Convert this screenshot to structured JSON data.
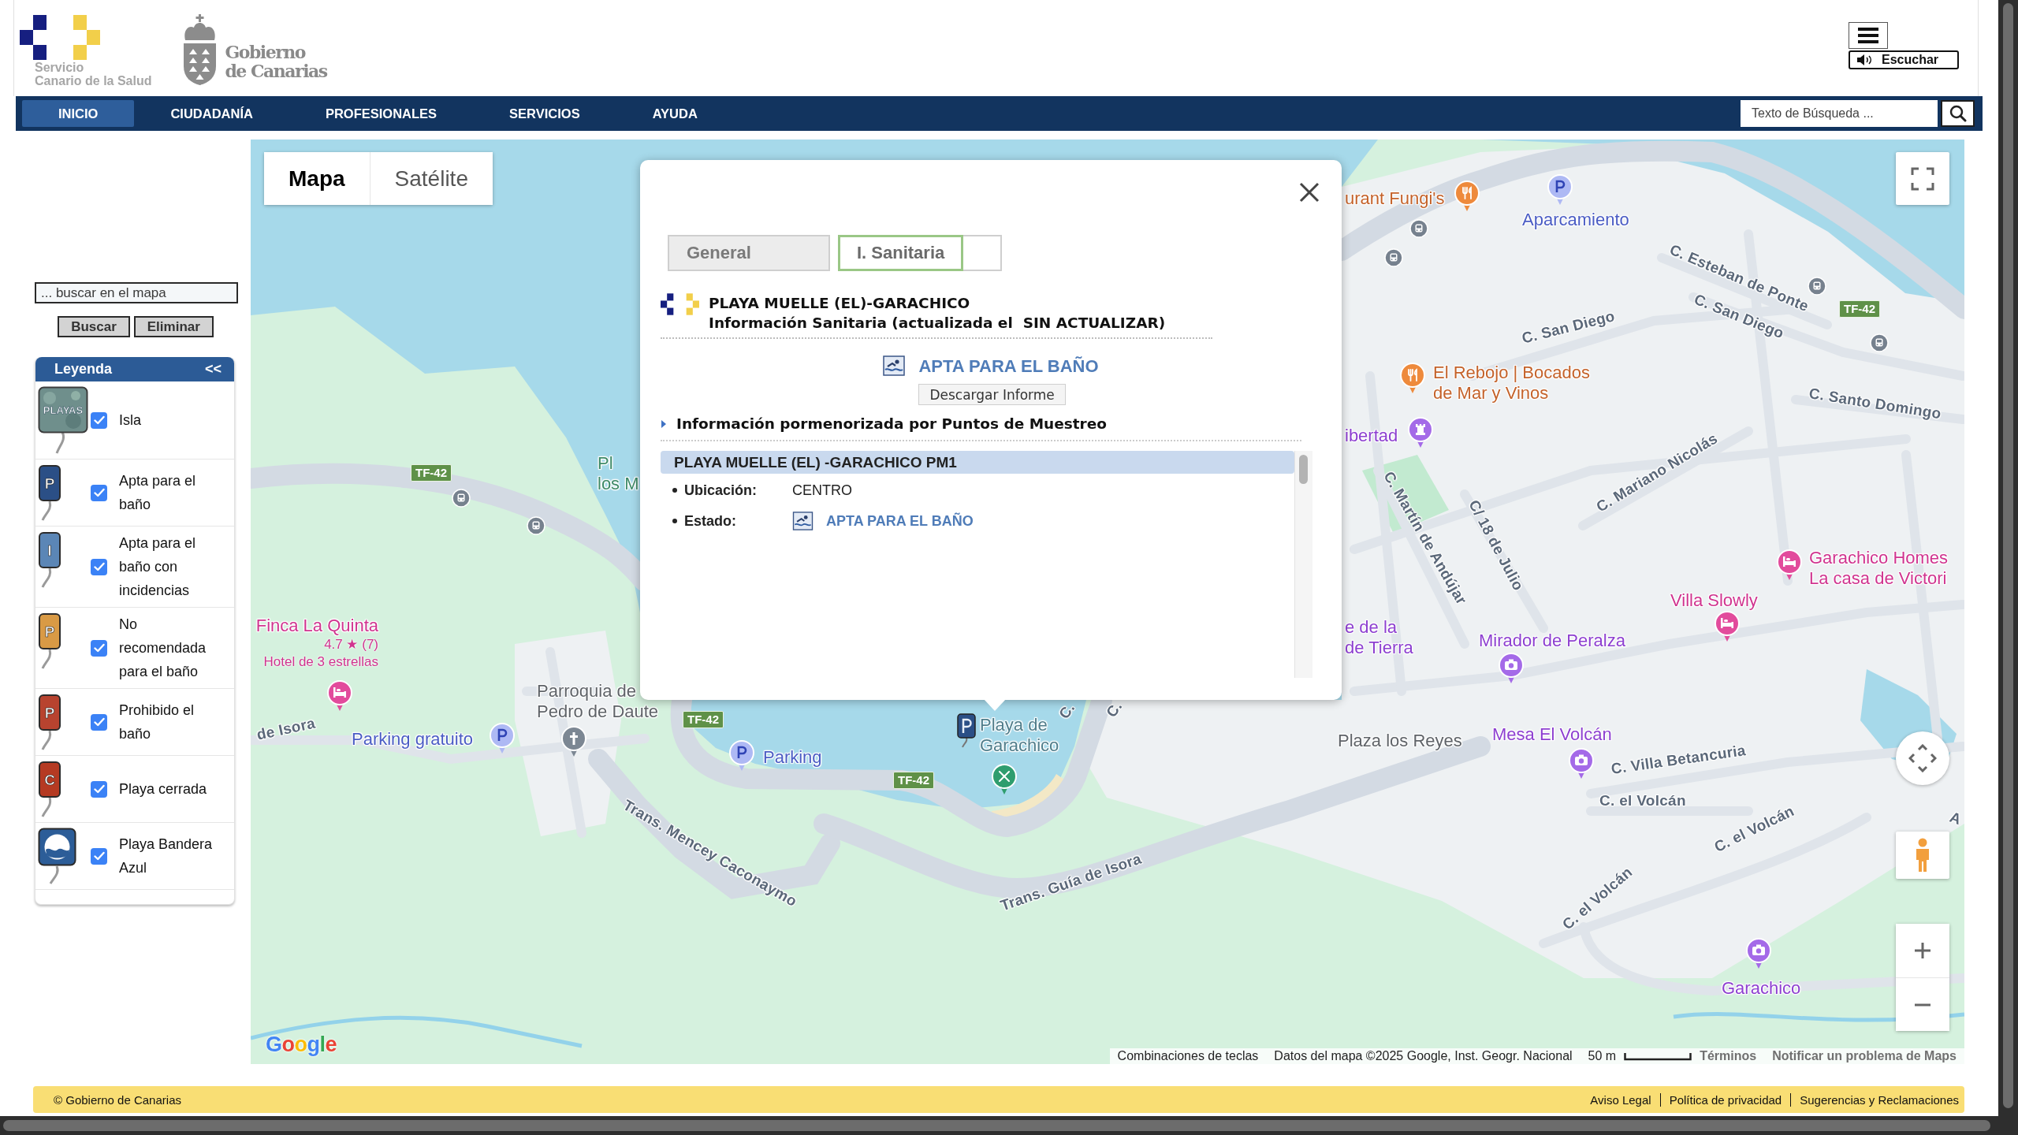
{
  "header": {
    "health_logo": [
      "Servicio",
      "Canario de la Salud"
    ],
    "government_logo": [
      "Gobierno",
      "de Canarias"
    ],
    "listen_button": "Escuchar"
  },
  "nav": {
    "items": [
      {
        "label": "INICIO",
        "selected": true
      },
      {
        "label": "CIUDADANÍA",
        "selected": false
      },
      {
        "label": "PROFESIONALES",
        "selected": false
      },
      {
        "label": "SERVICIOS",
        "selected": false
      },
      {
        "label": "AYUDA",
        "selected": false
      }
    ],
    "search": {
      "placeholder": "Texto de Búsqueda ..."
    }
  },
  "sidebar": {
    "search": {
      "placeholder": "... buscar en el mapa"
    },
    "buttons": [
      "Buscar",
      "Eliminar"
    ],
    "legend": {
      "title": "Leyenda",
      "collapse": "<<",
      "items": [
        {
          "label": "Isla",
          "checked": true,
          "kind": "photo",
          "marker_text": "PLAYAS"
        },
        {
          "label": "Apta para el baño",
          "checked": true,
          "kind": "sign",
          "marker_text": "P",
          "color": "#2b4f86"
        },
        {
          "label": "Apta para el baño con incidencias",
          "checked": true,
          "kind": "sign",
          "marker_text": "I",
          "color": "#5b86b6"
        },
        {
          "label": "No recomendada para el baño",
          "checked": true,
          "kind": "sign",
          "marker_text": "P",
          "color": "#d99a45"
        },
        {
          "label": "Prohibido el baño",
          "checked": true,
          "kind": "sign",
          "marker_text": "P",
          "color": "#b8432f"
        },
        {
          "label": "Playa cerrada",
          "checked": true,
          "kind": "sign",
          "marker_text": "C",
          "color": "#b53a22"
        },
        {
          "label": "Playa Bandera Azul",
          "checked": true,
          "kind": "flag"
        }
      ]
    }
  },
  "map": {
    "type_control": [
      {
        "label": "Mapa",
        "selected": true
      },
      {
        "label": "Satélite",
        "selected": false
      }
    ],
    "labels": [
      {
        "kind": "restaurant",
        "lines": [
          "urant Fungi's"
        ]
      },
      {
        "kind": "parking",
        "lines": [
          "Aparcamiento"
        ]
      },
      {
        "kind": "street",
        "lines": [
          "C. Esteban de Ponte"
        ]
      },
      {
        "kind": "street",
        "lines": [
          "C. San Diego"
        ]
      },
      {
        "kind": "street",
        "lines": [
          "C. San Diego"
        ]
      },
      {
        "kind": "road",
        "lines": [
          "TF-42"
        ]
      },
      {
        "kind": "restaurant",
        "lines": [
          "El Rebojo | Bocados",
          "de Mar y Vinos"
        ]
      },
      {
        "kind": "street",
        "lines": [
          "C. Santo Domingo"
        ]
      },
      {
        "kind": "sight",
        "lines": [
          "ibertad"
        ]
      },
      {
        "kind": "road",
        "lines": [
          "TF-42"
        ]
      },
      {
        "kind": "park",
        "lines": [
          "Pl",
          "los M"
        ]
      },
      {
        "kind": "street",
        "lines": [
          "C. Martín de Andújar"
        ]
      },
      {
        "kind": "street",
        "lines": [
          "C/ 18 de Julio"
        ]
      },
      {
        "kind": "street",
        "lines": [
          "C. Mariano Nicolás"
        ]
      },
      {
        "kind": "hotel",
        "lines": [
          "Garachico Homes",
          "La casa de Victori"
        ]
      },
      {
        "kind": "hotel",
        "lines": [
          "Villa Slowly"
        ]
      },
      {
        "kind": "hotel",
        "lines": [
          "Finca La Quinta"
        ],
        "details": [
          "4.7 ★ (7)",
          "Hotel de 3 estrellas"
        ]
      },
      {
        "kind": "sight",
        "lines": [
          "e de la",
          "de Tierra"
        ]
      },
      {
        "kind": "sight",
        "lines": [
          "Mirador de Peralza"
        ]
      },
      {
        "kind": "street",
        "lines": [
          "de Isora"
        ]
      },
      {
        "kind": "parking",
        "lines": [
          "Parking gratuito"
        ]
      },
      {
        "kind": "place",
        "lines": [
          "Parroquia de",
          "Pedro de Daute"
        ]
      },
      {
        "kind": "road",
        "lines": [
          "TF-42"
        ]
      },
      {
        "kind": "parking",
        "lines": [
          "Parking"
        ]
      },
      {
        "kind": "road",
        "lines": [
          "TF-42"
        ]
      },
      {
        "kind": "beach",
        "lines": [
          "Playa de",
          "Garachico"
        ]
      },
      {
        "kind": "street",
        "lines": [
          "C."
        ]
      },
      {
        "kind": "street",
        "lines": [
          "C."
        ]
      },
      {
        "kind": "place",
        "lines": [
          "Plaza los Reyes"
        ]
      },
      {
        "kind": "sight",
        "lines": [
          "Mesa El Volcán"
        ]
      },
      {
        "kind": "street",
        "lines": [
          "C. Villa Betancuria"
        ]
      },
      {
        "kind": "street",
        "lines": [
          "Trans. Mencey Caconaymo"
        ]
      },
      {
        "kind": "street",
        "lines": [
          "C. el Volcán"
        ]
      },
      {
        "kind": "street",
        "lines": [
          "A"
        ]
      },
      {
        "kind": "street",
        "lines": [
          "Trans. Guía de Isora"
        ]
      },
      {
        "kind": "street",
        "lines": [
          "C. el Volcán"
        ]
      },
      {
        "kind": "street",
        "lines": [
          "C. el Volcán"
        ]
      },
      {
        "kind": "sight",
        "lines": [
          "Garachico"
        ]
      }
    ],
    "logo": "Google",
    "attribution": {
      "shortcuts": "Combinaciones de teclas",
      "data": "Datos del mapa ©2025 Google, Inst. Geogr. Nacional",
      "scale": "50 m",
      "terms": "Términos",
      "report": "Notificar un problema de Maps"
    }
  },
  "popup": {
    "tabs": [
      {
        "label": "General",
        "selected": false
      },
      {
        "label": "I. Sanitaria",
        "selected": true
      },
      {
        "selected": false
      }
    ],
    "title": "PLAYA MUELLE (EL)-GARACHICO",
    "subtitle": "Información Sanitaria (actualizada el  SIN ACTUALIZAR)",
    "status": "APTA PARA EL BAÑO",
    "download_button": "Descargar Informe",
    "section_title": "Información pormenorizada por Puntos de Muestreo",
    "sampling_points": [
      {
        "name": "PLAYA MUELLE (EL) -GARACHICO PM1",
        "fields": [
          {
            "label": "Ubicación:",
            "value": "CENTRO",
            "kind": "text"
          },
          {
            "label": "Estado:",
            "value": "APTA PARA EL BAÑO",
            "kind": "status"
          }
        ]
      }
    ]
  },
  "footer": {
    "copyright": "© Gobierno de Canarias",
    "links": [
      "Aviso Legal",
      "Política de privacidad",
      "Sugerencias y Reclamaciones"
    ]
  }
}
